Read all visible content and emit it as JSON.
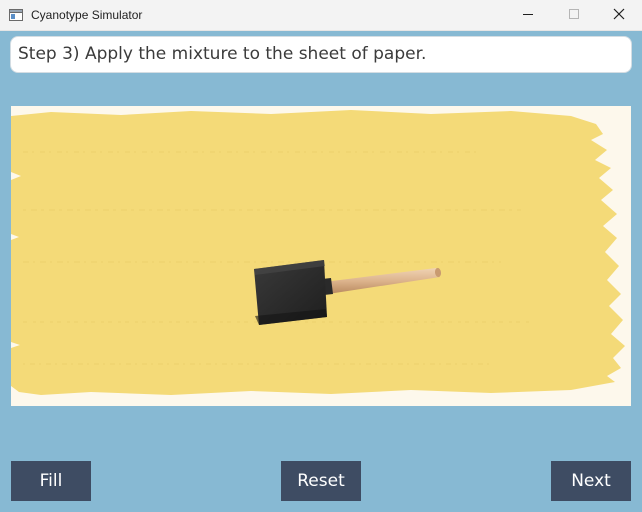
{
  "window": {
    "title": "Cyanotype Simulator",
    "icons": {
      "app": "app-window-icon",
      "minimize": "minimize-icon",
      "maximize": "maximize-icon",
      "close": "close-icon"
    }
  },
  "instruction": {
    "text": "Step 3) Apply the mixture to the sheet of paper."
  },
  "canvas": {
    "paper_color": "#fdf8ec",
    "paint_color": "#f4da78",
    "tool": "foam-brush"
  },
  "buttons": {
    "fill": "Fill",
    "reset": "Reset",
    "next": "Next"
  },
  "colors": {
    "background": "#87b9d3",
    "button": "#3e4c63",
    "button_text": "#ffffff"
  }
}
